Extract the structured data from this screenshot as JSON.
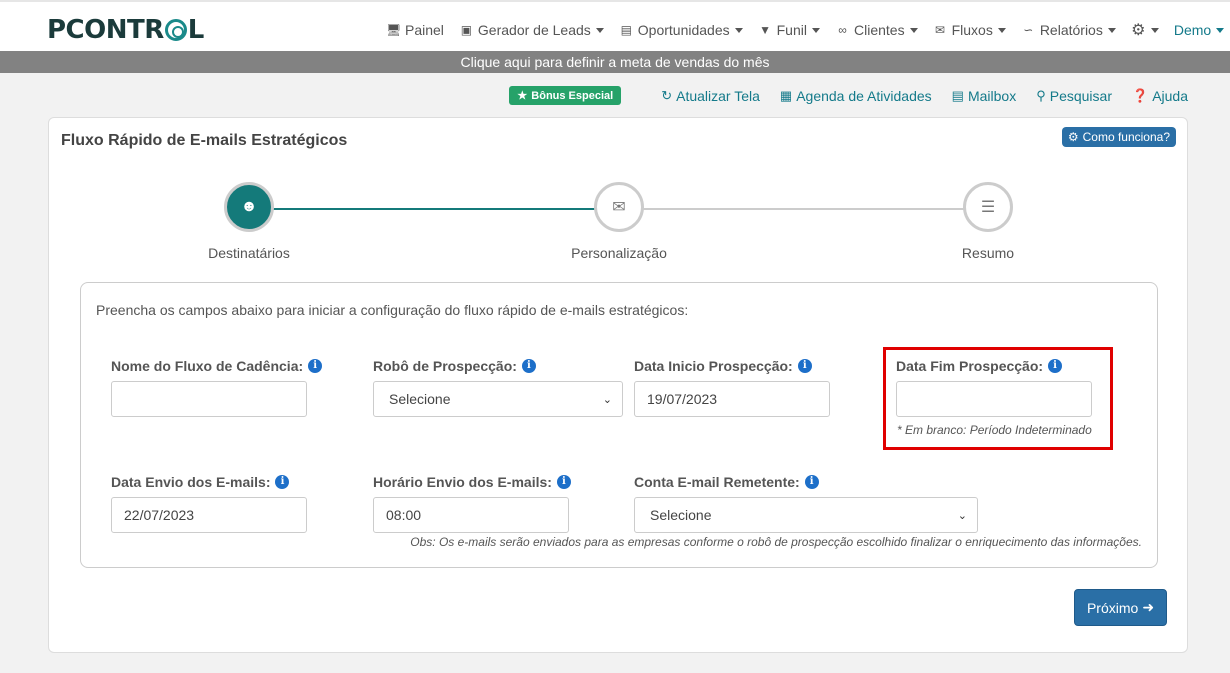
{
  "header": {
    "logo_text": "PCONTROL",
    "nav": [
      {
        "label": "Painel",
        "icon": "monitor-icon",
        "dropdown": false
      },
      {
        "label": "Gerador de Leads",
        "icon": "robot-icon",
        "dropdown": true
      },
      {
        "label": "Oportunidades",
        "icon": "clipboard-icon",
        "dropdown": true
      },
      {
        "label": "Funil",
        "icon": "funnel-icon",
        "dropdown": true
      },
      {
        "label": "Clientes",
        "icon": "handshake-icon",
        "dropdown": true
      },
      {
        "label": "Fluxos",
        "icon": "envelope-icon",
        "dropdown": true
      },
      {
        "label": "Relatórios",
        "icon": "line-chart-icon",
        "dropdown": true
      },
      {
        "label": "",
        "icon": "gear-icon",
        "dropdown": true
      },
      {
        "label": "Demo",
        "icon": "",
        "dropdown": true
      }
    ]
  },
  "goal_banner": "Clique aqui para definir a meta de vendas do mês",
  "toolbar": {
    "bonus": "Bônus Especial",
    "refresh": "Atualizar Tela",
    "agenda": "Agenda de Atividades",
    "mailbox": "Mailbox",
    "search": "Pesquisar",
    "help": "Ajuda"
  },
  "card": {
    "title": "Fluxo Rápido de E-mails Estratégicos",
    "how_it_works": "Como funciona?",
    "steps": [
      {
        "label": "Destinatários",
        "icon": "users-icon",
        "active": true
      },
      {
        "label": "Personalização",
        "icon": "envelope-icon",
        "active": false
      },
      {
        "label": "Resumo",
        "icon": "list-icon",
        "active": false
      }
    ],
    "intro": "Preencha os campos abaixo para iniciar a configuração do fluxo rápido de e-mails estratégicos:",
    "fields": {
      "flow_name": {
        "label": "Nome do Fluxo de Cadência:",
        "value": ""
      },
      "robot": {
        "label": "Robô de Prospecção:",
        "value": "Selecione"
      },
      "start_date": {
        "label": "Data Inicio Prospecção:",
        "value": "19/07/2023"
      },
      "end_date": {
        "label": "Data Fim Prospecção:",
        "value": "",
        "hint": "* Em branco: Período Indeterminado"
      },
      "send_date": {
        "label": "Data Envio dos E-mails:",
        "value": "22/07/2023"
      },
      "send_time": {
        "label": "Horário Envio dos E-mails:",
        "value": "08:00"
      },
      "sender_account": {
        "label": "Conta E-mail Remetente:",
        "value": "Selecione"
      }
    },
    "obs": "Obs: Os e-mails serão enviados para as empresas conforme o robô de prospecção escolhido finalizar o enriquecimento das informações.",
    "next_button": "Próximo"
  },
  "colors": {
    "brand_teal": "#147a7a",
    "primary_button": "#2a6fa6",
    "highlight_red": "#e00000",
    "bonus_green": "#26a269"
  }
}
